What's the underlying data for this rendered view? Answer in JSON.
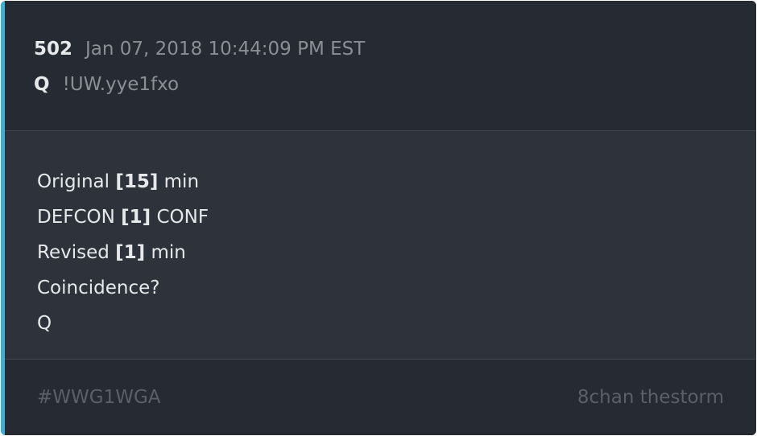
{
  "post": {
    "number": "502",
    "timestamp": "Jan 07, 2018 10:44:09 PM EST",
    "author": "Q",
    "tripcode": "!UW.yye1fxo"
  },
  "message": {
    "line1": {
      "pre": "Original ",
      "bold": "[15]",
      "post": " min"
    },
    "line2": {
      "pre": "DEFCON ",
      "bold": "[1]",
      "post": " CONF"
    },
    "line3": {
      "pre": "Revised ",
      "bold": "[1]",
      "post": " min"
    },
    "line4": "Coincidence?",
    "line5": "Q"
  },
  "footer": {
    "hashtag": "#WWG1WGA",
    "source": "8chan thestorm"
  },
  "colors": {
    "accent": "#3bb1d6",
    "card_bg": "#262a33",
    "body_bg": "#2e333b"
  }
}
